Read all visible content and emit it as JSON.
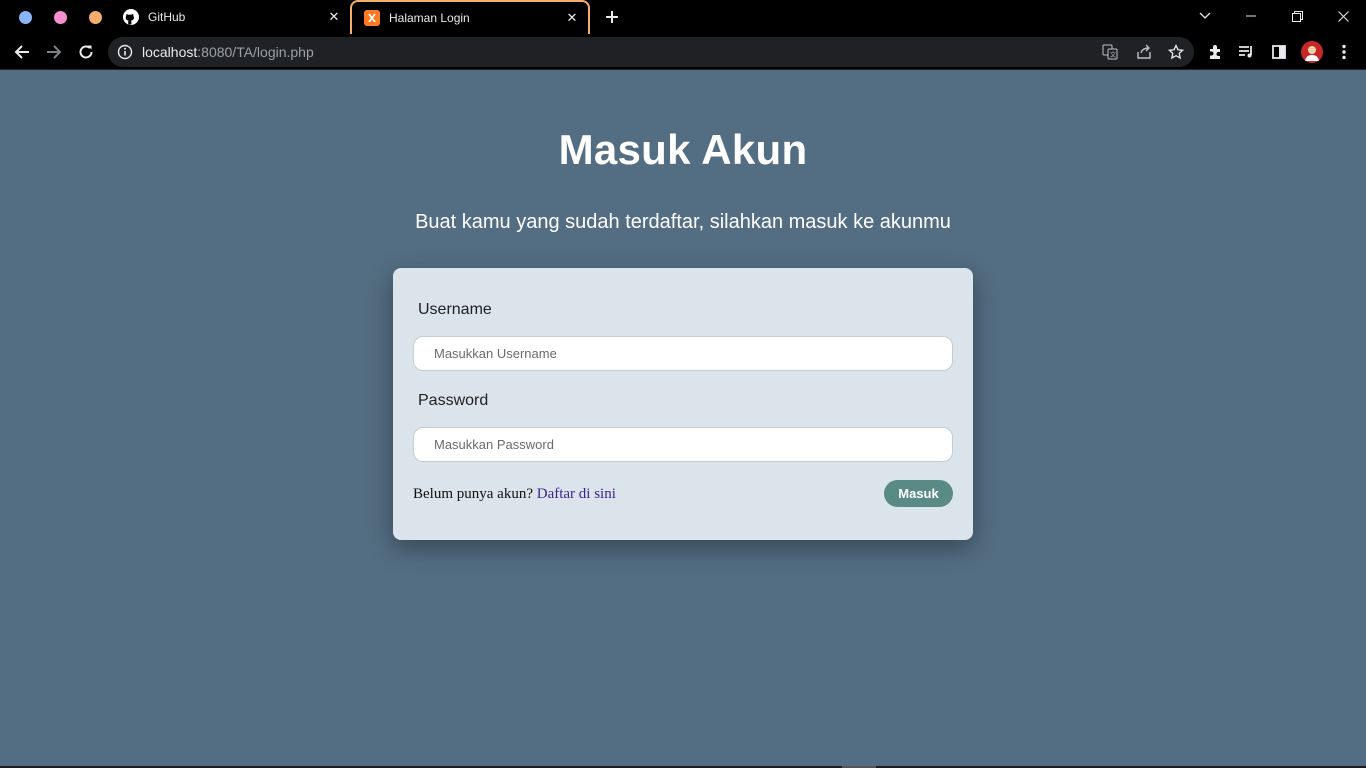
{
  "tabs": {
    "github_title": "GitHub",
    "login_title": "Halaman Login"
  },
  "toolbar": {
    "url_host": "localhost",
    "url_rest": ":8080/TA/login.php"
  },
  "page": {
    "title": "Masuk Akun",
    "subtitle": "Buat kamu yang sudah terdaftar, silahkan masuk ke akunmu"
  },
  "form": {
    "username_label": "Username",
    "username_placeholder": "Masukkan Username",
    "username_value": "",
    "password_label": "Password",
    "password_placeholder": "Masukkan Password",
    "password_value": "",
    "register_prompt": "Belum punya akun?",
    "register_link": "Daftar di sini",
    "submit_label": "Masuk"
  },
  "colors": {
    "page_background": "#536d82",
    "card_background": "#dbe3eb",
    "submit_button": "#5a8a85",
    "active_tab_border": "#f6ad6c"
  },
  "icons": [
    "github-icon",
    "xampp-icon",
    "close-icon",
    "plus-icon",
    "chevron-down-icon",
    "minimize-icon",
    "restore-icon",
    "back-icon",
    "forward-icon",
    "reload-icon",
    "info-icon",
    "translate-icon",
    "share-icon",
    "star-icon",
    "extensions-icon",
    "media-icon",
    "sidepanel-icon",
    "avatar",
    "menu-icon"
  ]
}
